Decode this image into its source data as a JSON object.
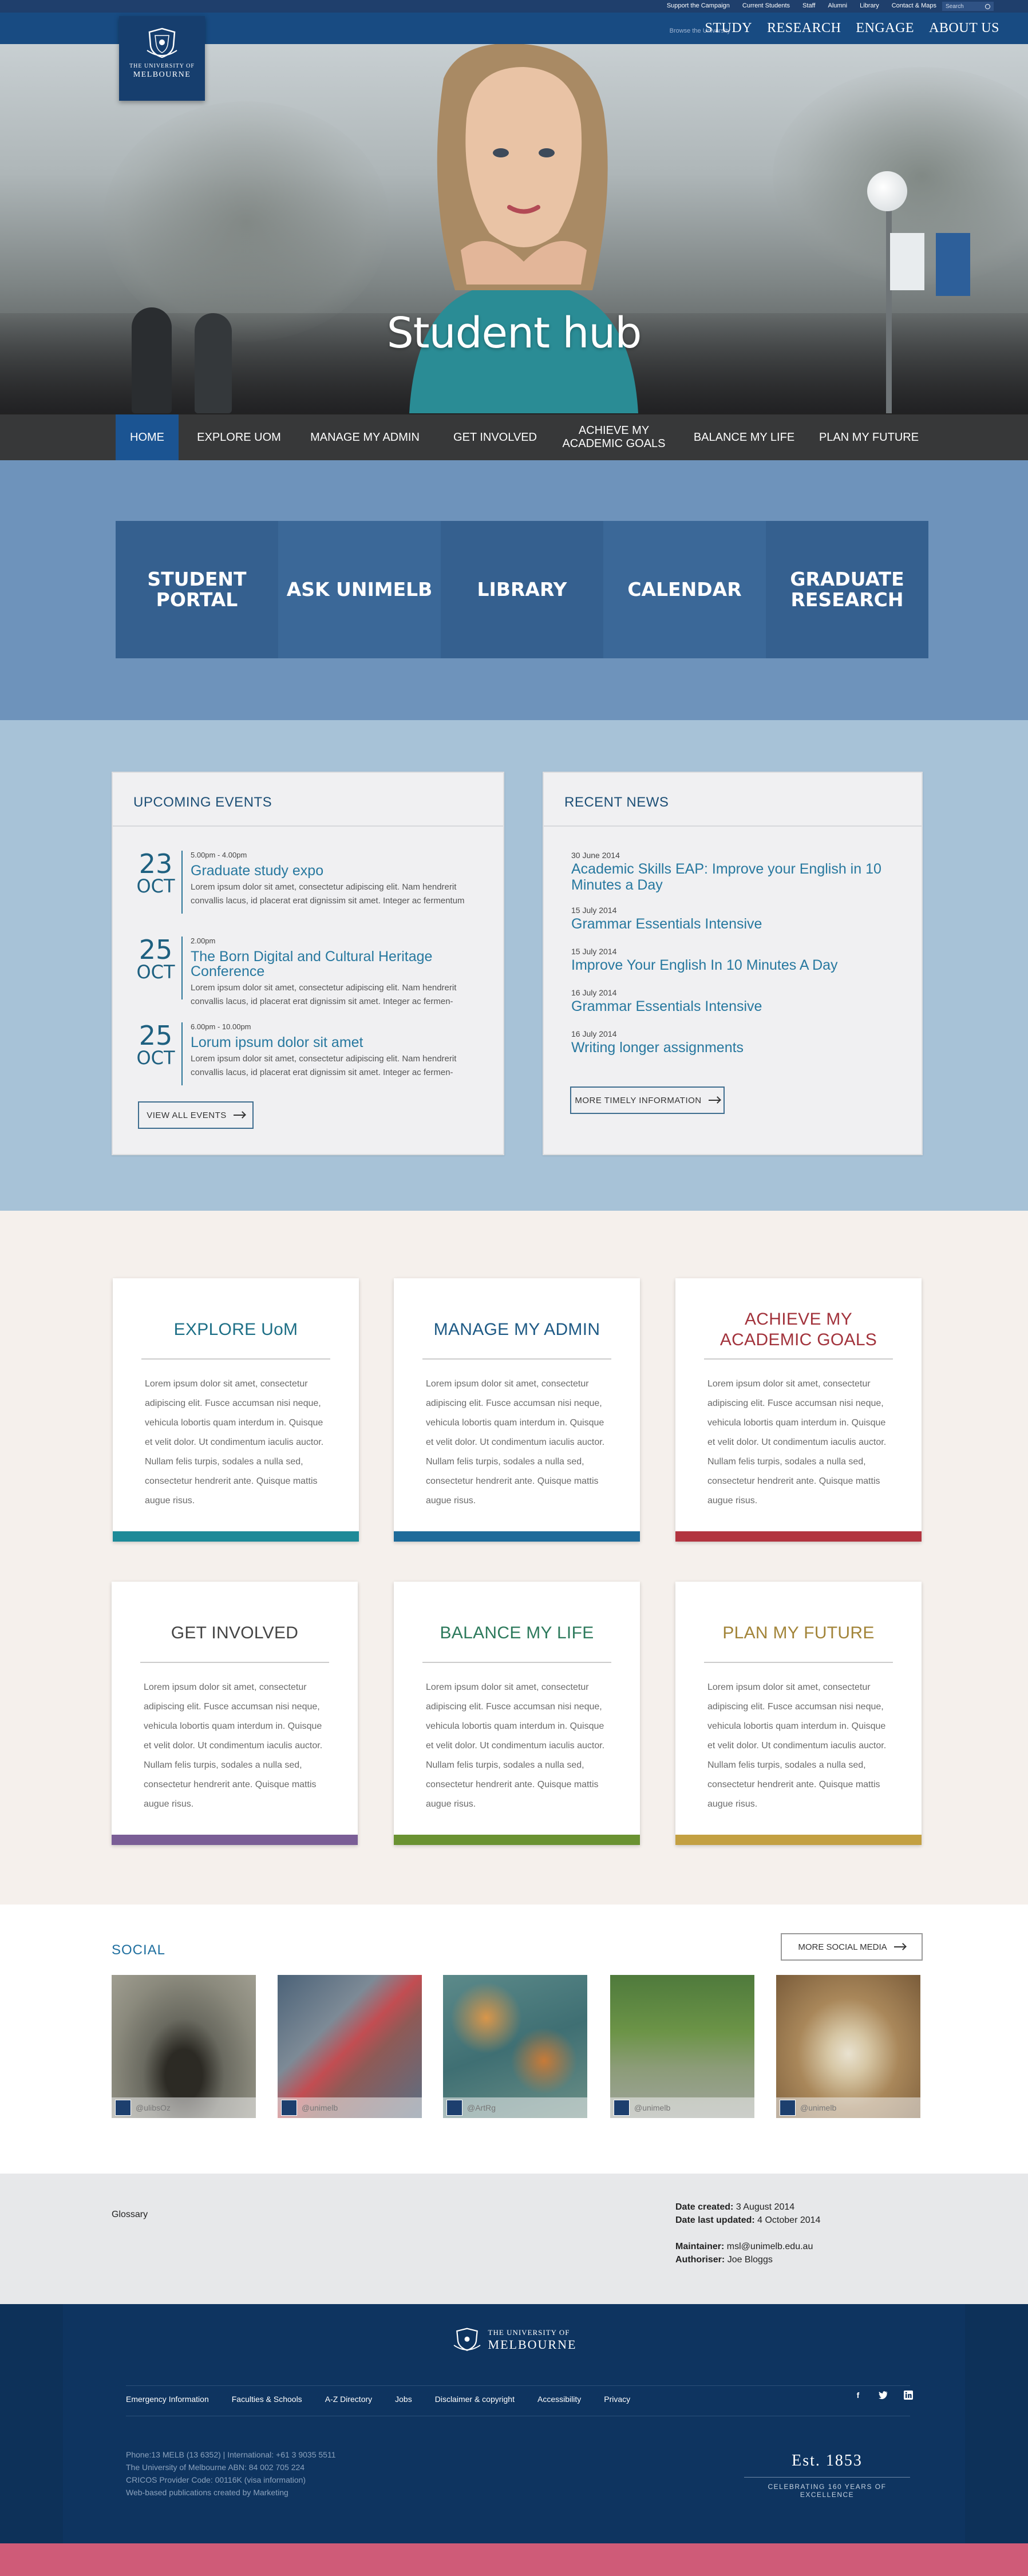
{
  "topbar": {
    "links": [
      "Support the Campaign",
      "Current Students",
      "Staff",
      "Alumni",
      "Library",
      "Contact & Maps"
    ],
    "search_placeholder": "Search"
  },
  "header": {
    "browse_label": "Browse the University",
    "nav": [
      "STUDY",
      "RESEARCH",
      "ENGAGE",
      "ABOUT US"
    ],
    "logo_line1": "THE UNIVERSITY OF",
    "logo_line2": "MELBOURNE"
  },
  "hero": {
    "title": "Student hub"
  },
  "section_nav": {
    "items": [
      "HOME",
      "EXPLORE UOM",
      "MANAGE MY ADMIN",
      "GET INVOLVED",
      "ACHIEVE MY ACADEMIC GOALS",
      "BALANCE MY LIFE",
      "PLAN MY FUTURE"
    ],
    "active": "HOME"
  },
  "quick_tiles": [
    "STUDENT PORTAL",
    "ASK UNIMELB",
    "LIBRARY",
    "CALENDAR",
    "GRADUATE RESEARCH"
  ],
  "events": {
    "heading": "UPCOMING EVENTS",
    "items": [
      {
        "day": "23",
        "month": "OCT",
        "time": "5.00pm - 4.00pm",
        "title": "Graduate study expo",
        "desc": "Lorem ipsum dolor sit amet, consectetur adipiscing elit. Nam hendrerit convallis lacus, id placerat erat dignissim sit amet. Integer ac fermentum"
      },
      {
        "day": "25",
        "month": "OCT",
        "time": "2.00pm",
        "title": "The Born Digital and Cultural Heritage Conference",
        "desc": "Lorem ipsum dolor sit amet, consectetur adipiscing elit. Nam hendrerit convallis lacus, id placerat erat dignissim sit amet. Integer ac fermen-"
      },
      {
        "day": "25",
        "month": "OCT",
        "time": "6.00pm - 10.00pm",
        "title": "Lorum ipsum dolor sit amet",
        "desc": "Lorem ipsum dolor sit amet, consectetur adipiscing elit. Nam hendrerit convallis lacus, id placerat erat dignissim sit amet. Integer ac fermen-"
      }
    ],
    "button": "VIEW ALL EVENTS"
  },
  "news": {
    "heading": "RECENT NEWS",
    "items": [
      {
        "date": "30 June 2014",
        "title": "Academic Skills EAP: Improve your English in 10 Minutes a Day"
      },
      {
        "date": "15 July 2014",
        "title": "Grammar Essentials Intensive"
      },
      {
        "date": "15 July 2014",
        "title": "Improve Your English In 10 Minutes A Day"
      },
      {
        "date": "16 July 2014",
        "title": "Grammar Essentials Intensive"
      },
      {
        "date": "16 July 2014",
        "title": "Writing longer assignments"
      }
    ],
    "button": "MORE TIMELY INFORMATION"
  },
  "cards": [
    {
      "title": "EXPLORE UoM",
      "color": "#1d8a98",
      "body": "Lorem ipsum dolor sit amet, consectetur adipiscing elit. Fusce accumsan nisi neque, vehicula lobortis quam interdum in. Quisque et velit dolor. Ut condimentum iaculis auctor. Nullam felis turpis, sodales a nulla sed, consectetur hendrerit ante. Quisque mattis augue risus."
    },
    {
      "title": "MANAGE MY ADMIN",
      "color": "#1e6b9a",
      "body": "Lorem ipsum dolor sit amet, consectetur adipiscing elit. Fusce accumsan nisi neque, vehicula lobortis quam interdum in. Quisque et velit dolor. Ut condimentum iaculis auctor. Nullam felis turpis, sodales a nulla sed, consectetur hendrerit ante. Quisque mattis augue risus."
    },
    {
      "title": "ACHIEVE MY ACADEMIC GOALS",
      "color": "#b2343f",
      "body": "Lorem ipsum dolor sit amet, consectetur adipiscing elit. Fusce accumsan nisi neque, vehicula lobortis quam interdum in. Quisque et velit dolor. Ut condimentum iaculis auctor. Nullam felis turpis, sodales a nulla sed, consectetur hendrerit ante. Quisque mattis augue risus."
    },
    {
      "title": "GET INVOLVED",
      "color": "#7a5e96",
      "body": "Lorem ipsum dolor sit amet, consectetur adipiscing elit. Fusce accumsan nisi neque, vehicula lobortis quam interdum in. Quisque et velit dolor. Ut condimentum iaculis auctor. Nullam felis turpis, sodales a nulla sed, consectetur hendrerit ante. Quisque mattis augue risus."
    },
    {
      "title": "BALANCE MY LIFE",
      "color": "#6a9232",
      "body": "Lorem ipsum dolor sit amet, consectetur adipiscing elit. Fusce accumsan nisi neque, vehicula lobortis quam interdum in. Quisque et velit dolor. Ut condimentum iaculis auctor. Nullam felis turpis, sodales a nulla sed, consectetur hendrerit ante. Quisque mattis augue risus."
    },
    {
      "title": "PLAN MY FUTURE",
      "color": "#c3a042",
      "body": "Lorem ipsum dolor sit amet, consectetur adipiscing elit. Fusce accumsan nisi neque, vehicula lobortis quam interdum in. Quisque et velit dolor. Ut condimentum iaculis auctor. Nullam felis turpis, sodales a nulla sed, consectetur hendrerit ante. Quisque mattis augue risus."
    }
  ],
  "social": {
    "heading": "SOCIAL",
    "button": "MORE SOCIAL MEDIA",
    "posts": [
      {
        "handle": "@ulibsOz"
      },
      {
        "handle": "@unimelb"
      },
      {
        "handle": "@ArtRg"
      },
      {
        "handle": "@unimelb"
      },
      {
        "handle": "@unimelb"
      }
    ]
  },
  "meta": {
    "glossary": "Glossary",
    "date_created_label": "Date created:",
    "date_created": "3 August 2014",
    "date_updated_label": "Date last updated:",
    "date_updated": "4 October 2014",
    "maintainer_label": "Maintainer:",
    "maintainer": "msl@unimelb.edu.au",
    "authoriser_label": "Authoriser:",
    "authoriser": "Joe Bloggs"
  },
  "footer": {
    "logo_line1": "THE UNIVERSITY OF",
    "logo_line2": "MELBOURNE",
    "links": [
      "Emergency Information",
      "Faculties & Schools",
      "A-Z Directory",
      "Jobs",
      "Disclaimer & copyright",
      "Accessibility",
      "Privacy"
    ],
    "social_icons": [
      "facebook-icon",
      "twitter-icon",
      "linkedin-icon"
    ],
    "contact": [
      "Phone:13 MELB (13 6352) | International: +61 3 9035 5511",
      "The University of Melbourne ABN: 84 002 705 224",
      "CRICOS Provider Code: 00116K (visa information)",
      "Web-based publications created by Marketing"
    ],
    "est": "Est. 1853",
    "celebrating": "CELEBRATING 160 YEARS OF EXCELLENCE"
  }
}
